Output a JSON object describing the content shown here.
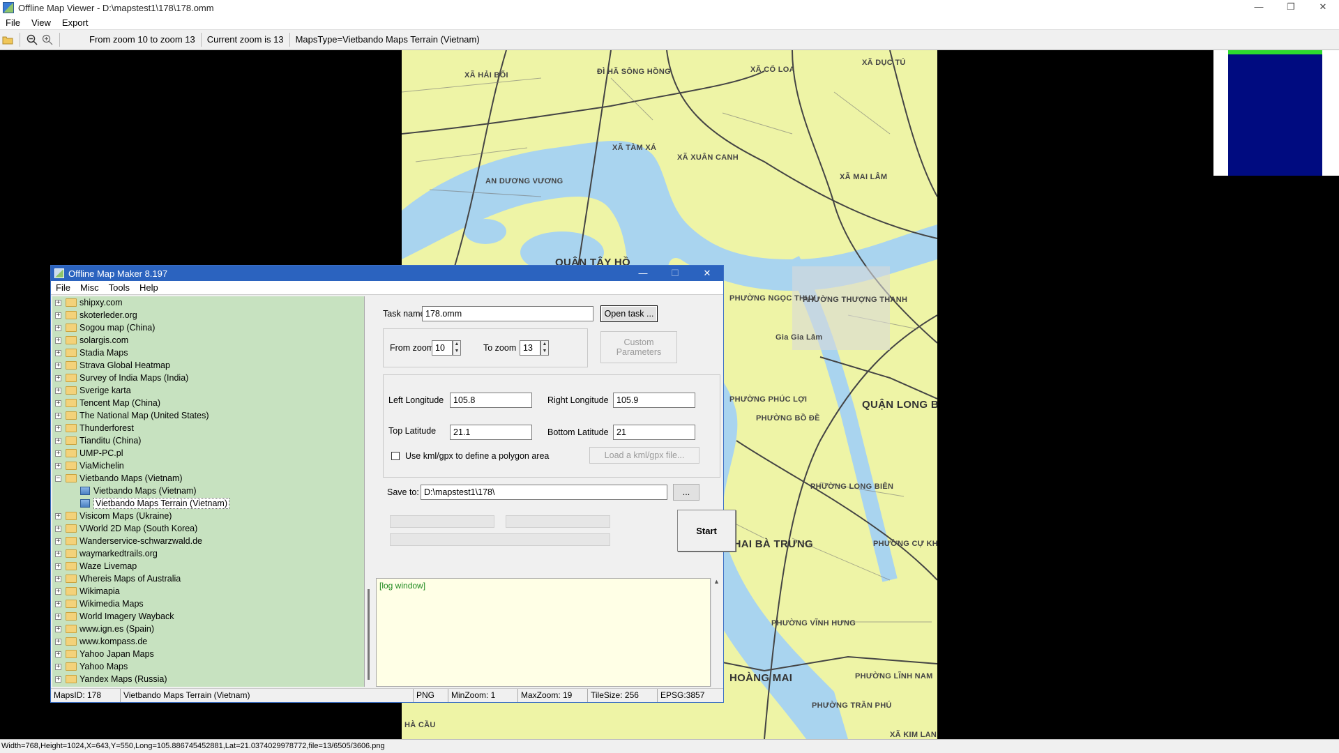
{
  "window": {
    "title": "Offline Map Viewer - D:\\mapstest1\\178\\178.omm",
    "controls": [
      "—",
      "❐",
      "✕"
    ]
  },
  "menu": [
    "File",
    "View",
    "Export"
  ],
  "toolbar": {
    "zoom_range": "From zoom 10 to zoom 13",
    "current_zoom": "Current zoom is 13",
    "maps_type": "MapsType=Vietbando Maps Terrain (Vietnam)"
  },
  "map_labels": [
    {
      "text": "XÃ HẢI BỐI"
    },
    {
      "text": "ĐÌ HÃ SÔNG HỒNG"
    },
    {
      "text": "XÃ CỔ LOA"
    },
    {
      "text": "XÃ DỤC TÚ"
    },
    {
      "text": "XÃ TÀM XÁ"
    },
    {
      "text": "XÃ XUÂN CANH"
    },
    {
      "text": "XÃ MAI LÂM"
    },
    {
      "text": "AN DƯƠNG VƯƠNG"
    },
    {
      "text": "QUẬN TÂY HỒ"
    },
    {
      "text": "PHƯỜNG NGỌC THỤY"
    },
    {
      "text": "PHƯỜNG THƯỢNG THANH"
    },
    {
      "text": "Gia Gia Lâm"
    },
    {
      "text": "QUẬN LONG BIÊN"
    },
    {
      "text": "PHƯỜNG BỒ ĐỀ"
    },
    {
      "text": "PHƯỜNG LONG BIÊN"
    },
    {
      "text": "PHƯỜNG PHÚC LỢI"
    },
    {
      "text": "N HAI BÀ TRƯNG"
    },
    {
      "text": "PHƯỜNG VĨNH HƯNG"
    },
    {
      "text": "PHƯỜNG CỰ KHỐI"
    },
    {
      "text": "HOÀNG MAI"
    },
    {
      "text": "PHƯỜNG LĨNH NAM"
    },
    {
      "text": "PHƯỜNG TRẦN PHÚ"
    },
    {
      "text": "XÃ KIM LAN"
    },
    {
      "text": "HÀ CẦU"
    }
  ],
  "statusbar": "Width=768,Height=1024,X=643,Y=550,Long=105.886745452881,Lat=21.0374029978772,file=13/6505/3606.png",
  "dialog": {
    "title": "Offline Map Maker 8.197",
    "controls": [
      "—",
      "☐",
      "✕"
    ],
    "menu": [
      "File",
      "Misc",
      "Tools",
      "Help"
    ],
    "tree": [
      {
        "label": "shipxy.com",
        "level": 0,
        "expander": "+"
      },
      {
        "label": "skoterleder.org",
        "level": 0,
        "expander": "+"
      },
      {
        "label": "Sogou map (China)",
        "level": 0,
        "expander": "+"
      },
      {
        "label": "solargis.com",
        "level": 0,
        "expander": "+"
      },
      {
        "label": "Stadia Maps",
        "level": 0,
        "expander": "+"
      },
      {
        "label": "Strava Global Heatmap",
        "level": 0,
        "expander": "+"
      },
      {
        "label": "Survey of India Maps (India)",
        "level": 0,
        "expander": "+"
      },
      {
        "label": "Sverige karta",
        "level": 0,
        "expander": "+"
      },
      {
        "label": "Tencent Map (China)",
        "level": 0,
        "expander": "+"
      },
      {
        "label": "The National Map (United States)",
        "level": 0,
        "expander": "+"
      },
      {
        "label": "Thunderforest",
        "level": 0,
        "expander": "+"
      },
      {
        "label": "Tianditu (China)",
        "level": 0,
        "expander": "+"
      },
      {
        "label": "UMP-PC.pl",
        "level": 0,
        "expander": "+"
      },
      {
        "label": "ViaMichelin",
        "level": 0,
        "expander": "+"
      },
      {
        "label": "Vietbando Maps (Vietnam)",
        "level": 0,
        "expander": "−"
      },
      {
        "label": "Vietbando Maps (Vietnam)",
        "level": 1
      },
      {
        "label": "Vietbando Maps Terrain (Vietnam)",
        "level": 1,
        "selected": true
      },
      {
        "label": "Visicom Maps (Ukraine)",
        "level": 0,
        "expander": "+"
      },
      {
        "label": "VWorld 2D Map (South Korea)",
        "level": 0,
        "expander": "+"
      },
      {
        "label": "Wanderservice-schwarzwald.de",
        "level": 0,
        "expander": "+"
      },
      {
        "label": "waymarkedtrails.org",
        "level": 0,
        "expander": "+"
      },
      {
        "label": "Waze Livemap",
        "level": 0,
        "expander": "+"
      },
      {
        "label": "Whereis Maps of Australia",
        "level": 0,
        "expander": "+"
      },
      {
        "label": "Wikimapia",
        "level": 0,
        "expander": "+"
      },
      {
        "label": "Wikimedia Maps",
        "level": 0,
        "expander": "+"
      },
      {
        "label": "World Imagery Wayback",
        "level": 0,
        "expander": "+"
      },
      {
        "label": "www.ign.es (Spain)",
        "level": 0,
        "expander": "+"
      },
      {
        "label": "www.kompass.de",
        "level": 0,
        "expander": "+"
      },
      {
        "label": "Yahoo Japan Maps",
        "level": 0,
        "expander": "+"
      },
      {
        "label": "Yahoo Maps",
        "level": 0,
        "expander": "+"
      },
      {
        "label": "Yandex Maps (Russia)",
        "level": 0,
        "expander": "+"
      }
    ],
    "form": {
      "task_name_label": "Task name",
      "task_name_value": "178.omm",
      "open_task_label": "Open task ...",
      "from_zoom_label": "From zoom",
      "from_zoom_value": "10",
      "to_zoom_label": "To zoom",
      "to_zoom_value": "13",
      "custom_params_label": "Custom Parameters",
      "left_lon_label": "Left Longitude",
      "left_lon_value": "105.8",
      "right_lon_label": "Right Longitude",
      "right_lon_value": "105.9",
      "top_lat_label": "Top Latitude",
      "top_lat_value": "21.1",
      "bottom_lat_label": "Bottom Latitude",
      "bottom_lat_value": "21",
      "kml_checkbox_label": "Use kml/gpx to define a polygon area",
      "load_kml_label": "Load a kml/gpx file...",
      "save_to_label": "Save to:",
      "save_to_value": "D:\\mapstest1\\178\\",
      "browse_label": "...",
      "start_label": "Start"
    },
    "log_text": "[log window]",
    "status": {
      "maps_id": "MapsID: 178",
      "maps_name": "Vietbando Maps Terrain (Vietnam)",
      "format": "PNG",
      "min_zoom": "MinZoom: 1",
      "max_zoom": "MaxZoom: 19",
      "tile_size": "TileSize: 256",
      "epsg": "EPSG:3857"
    }
  }
}
